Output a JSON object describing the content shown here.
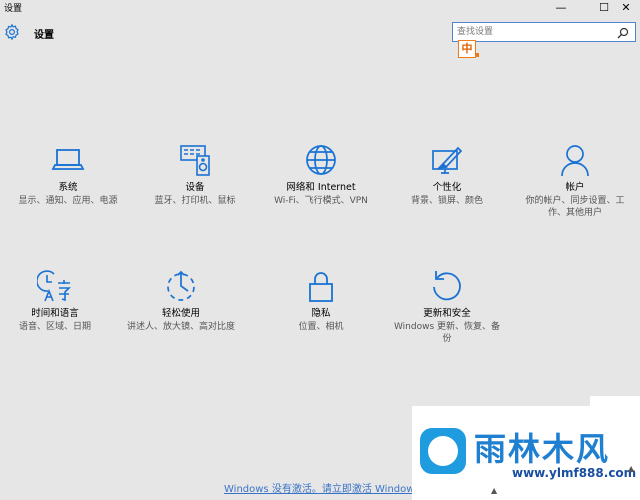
{
  "window": {
    "title": "设置",
    "minimize": "—",
    "maximize": "☐",
    "close": "✕"
  },
  "header": {
    "app_title": "设置",
    "search_placeholder": "查找设置",
    "ime_label": "中"
  },
  "tiles": [
    {
      "name": "系统",
      "desc": "显示、通知、应用、电源",
      "icon": "laptop-icon"
    },
    {
      "name": "设备",
      "desc": "蓝牙、打印机、鼠标",
      "icon": "devices-icon"
    },
    {
      "name": "网络和 Internet",
      "desc": "Wi-Fi、飞行模式、VPN",
      "icon": "globe-icon"
    },
    {
      "name": "个性化",
      "desc": "背景、锁屏、颜色",
      "icon": "personalization-icon"
    },
    {
      "name": "帐户",
      "desc": "你的帐户、同步设置、工作、其他用户",
      "icon": "person-icon"
    },
    {
      "name": "时间和语言",
      "desc": "语音、区域、日期",
      "icon": "time-language-icon"
    },
    {
      "name": "轻松使用",
      "desc": "讲述人、放大镜、高对比度",
      "icon": "ease-of-access-icon"
    },
    {
      "name": "隐私",
      "desc": "位置、相机",
      "icon": "lock-icon"
    },
    {
      "name": "更新和安全",
      "desc": "Windows 更新、恢复、备份",
      "icon": "update-icon"
    }
  ],
  "footer": {
    "activation_text": "Windows 没有激活。请立即激活 Windows。"
  },
  "watermark": {
    "text": "雨林木风",
    "url": "www.ylmf888.com"
  },
  "colors": {
    "accent": "#1a73d4",
    "background": "#e6e6e6"
  }
}
